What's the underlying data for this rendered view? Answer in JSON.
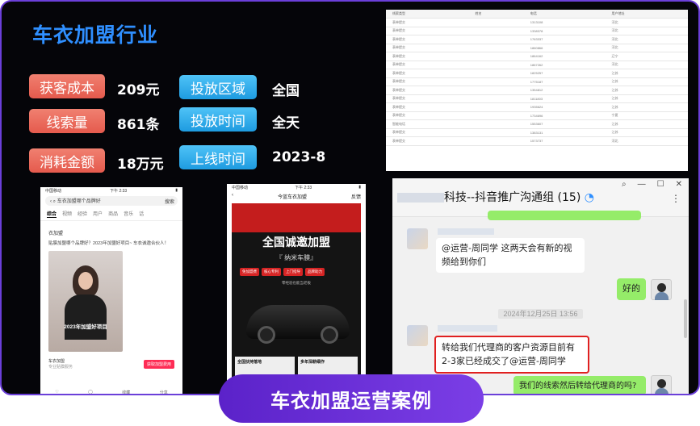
{
  "title": "车衣加盟行业",
  "metrics": [
    {
      "label": "获客成本",
      "value": "209元"
    },
    {
      "label": "线索量",
      "value": "861条"
    },
    {
      "label": "消耗金额",
      "value": "18万元"
    },
    {
      "label": "投放区域",
      "value": "全国"
    },
    {
      "label": "投放时间",
      "value": "全天"
    },
    {
      "label": "上线时间",
      "value": "2023-8"
    }
  ],
  "sheet": {
    "headers": [
      "线索类型",
      "姓名",
      "电话",
      "用户地址"
    ],
    "rows": [
      [
        "表单提交",
        "",
        "1313108",
        "河北"
      ],
      [
        "表单提交",
        "",
        "1338378",
        "河北"
      ],
      [
        "表单提交",
        "",
        "1763337",
        "河北"
      ],
      [
        "表单提交",
        "",
        "1860866",
        "河北"
      ],
      [
        "表单提交",
        "",
        "1864162",
        "辽宁"
      ],
      [
        "表单提交",
        "",
        "1867262",
        "河北"
      ],
      [
        "表单提交",
        "",
        "1825257",
        "江苏"
      ],
      [
        "表单提交",
        "",
        "1775187",
        "江苏"
      ],
      [
        "表单提交",
        "",
        "1354812",
        "江苏"
      ],
      [
        "表单提交",
        "",
        "1811803",
        "江苏"
      ],
      [
        "表单提交",
        "",
        "1935624",
        "江苏"
      ],
      [
        "表单提交",
        "",
        "1734696",
        "宁夏"
      ],
      [
        "智能电话",
        "",
        "1553607",
        "江苏"
      ],
      [
        "表单提交",
        "",
        "1383131",
        "江苏"
      ],
      [
        "表单提交",
        "",
        "1573737",
        "河北"
      ]
    ]
  },
  "phone1": {
    "status_left": "中国移动",
    "status_time": "下午 2:33",
    "search_text": "车衣加盟哪个品牌好",
    "search_btn": "搜索",
    "tabs": [
      "综合",
      "视频",
      "经验",
      "用户",
      "商品",
      "音乐",
      "话"
    ],
    "account": "衣加盟",
    "post": "贴膜加盟哪个品牌好？2023年加盟好项目~  车衣诚邀合伙人！",
    "video_caption": "2023年加盟好项目",
    "shop_name": "车衣加盟",
    "shop_sub": "专业贴膜服务",
    "shop_btn": "获取加盟费用",
    "bottom": [
      "♡",
      "◯",
      "收藏",
      "分享"
    ]
  },
  "phone2": {
    "status_left": "中国移动",
    "status_time": "下午 2:33",
    "nav_title": "今蓝车衣加盟",
    "nav_right": "反馈",
    "headline": "全国诚邀加盟",
    "product": "『      纳米车膜』",
    "tags": [
      "免加盟费",
      "核心专利",
      "上门指导",
      "品牌助力"
    ],
    "line": "零经验也能当老板",
    "cards": [
      "全国扶持落地",
      "多年深耕细作"
    ]
  },
  "chat": {
    "title": "科技--抖音推广沟通组 (15)",
    "window_controls": [
      "⌕",
      "—",
      "☐",
      "✕"
    ],
    "more": "⋮",
    "msg1": "@运营-周同学 这两天会有新的视频给到你们",
    "msg_me1": "好的",
    "timestamp": "2024年12月25日 13:56",
    "msg2": "转给我们代理商的客户资源目前有2-3家已经成交了@运营-周同学",
    "msg_me2": "我们的线索然后转给代理商的吗?"
  },
  "banner": "车衣加盟运营案例",
  "colors": {
    "accent_purple": "#6b3fd9",
    "title_blue": "#2f8fff",
    "pill_red": "#e55a4d",
    "pill_blue": "#1e9be0",
    "wechat_green": "#95ec69",
    "highlight_red": "#e02020"
  }
}
